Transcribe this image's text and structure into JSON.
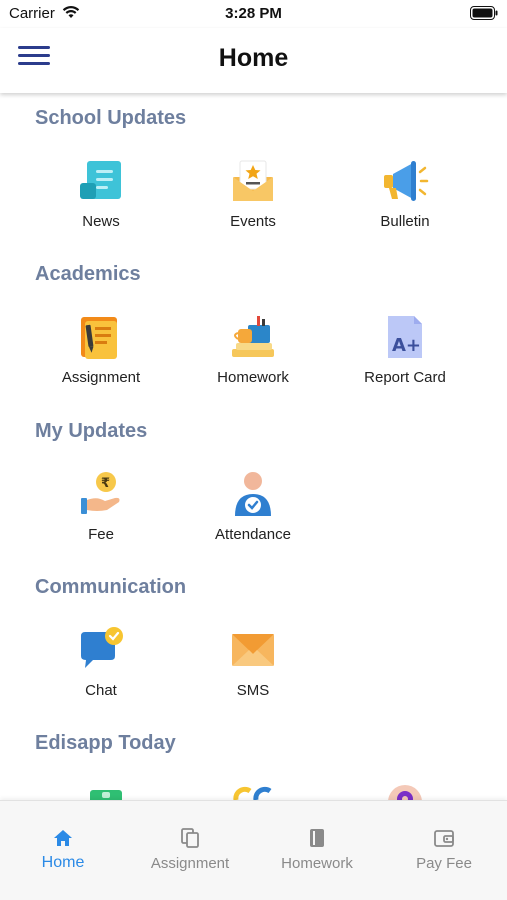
{
  "status_bar": {
    "carrier": "Carrier",
    "time": "3:28 PM"
  },
  "header": {
    "title": "Home"
  },
  "sections": {
    "school_updates": {
      "title": "School Updates",
      "items": [
        "News",
        "Events",
        "Bulletin"
      ]
    },
    "academics": {
      "title": "Academics",
      "items": [
        "Assignment",
        "Homework",
        "Report Card"
      ]
    },
    "my_updates": {
      "title": "My Updates",
      "items": [
        "Fee",
        "Attendance"
      ]
    },
    "communication": {
      "title": "Communication",
      "items": [
        "Chat",
        "SMS"
      ]
    },
    "edisapp_today": {
      "title": "Edisapp Today"
    }
  },
  "tab_bar": {
    "active": "Home",
    "tabs": [
      "Home",
      "Assignment",
      "Homework",
      "Pay Fee"
    ]
  },
  "colors": {
    "accent": "#2b8ae6",
    "section_title": "#6e7f9e",
    "menu": "#2b3c8c"
  }
}
